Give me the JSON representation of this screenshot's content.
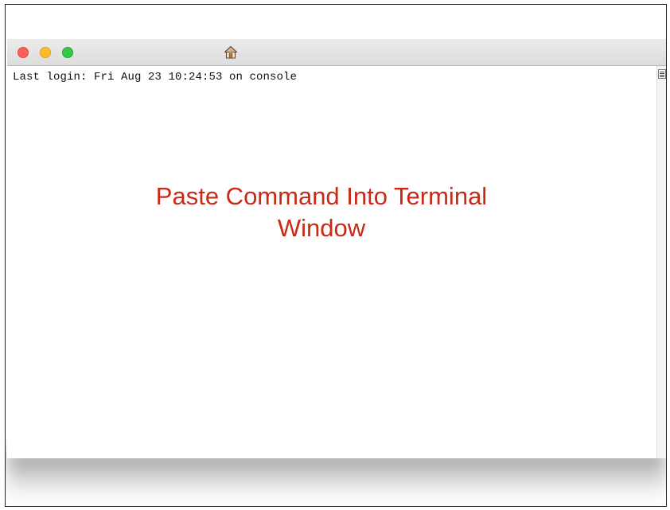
{
  "window": {
    "titlebar": {
      "buttons": {
        "close": {
          "color": "#fc5f57"
        },
        "minimize": {
          "color": "#fdbc2e"
        },
        "zoom": {
          "color": "#34c84a"
        }
      },
      "icon": "home-icon"
    },
    "terminal": {
      "lines": [
        "Last login: Fri Aug 23 10:24:53 on console"
      ]
    },
    "scrollbar": {
      "icon": "scroll-menu-icon"
    }
  },
  "annotation": {
    "text_line1": "Paste Command Into Terminal",
    "text_line2": "Window",
    "color": "#c92a16"
  }
}
